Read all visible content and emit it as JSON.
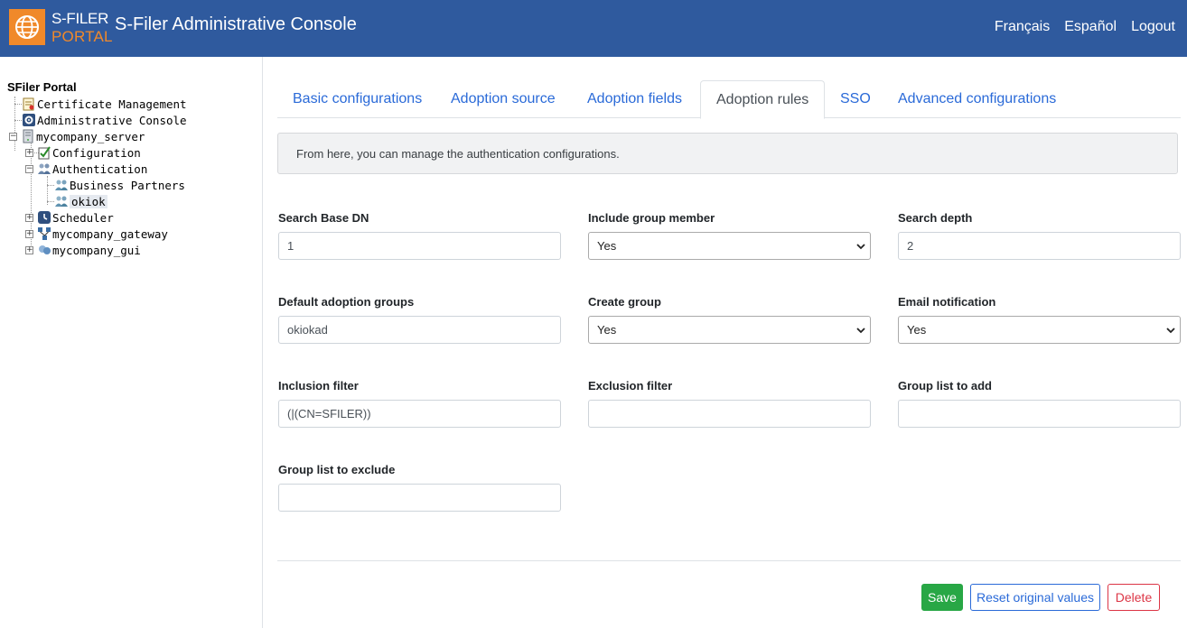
{
  "header": {
    "brand_line1": "S-FILER",
    "brand_line2": "PORTAL",
    "title": "S-Filer Administrative Console",
    "links": [
      "Français",
      "Español",
      "Logout"
    ]
  },
  "tree": {
    "root": "SFiler Portal",
    "items": {
      "cert": "Certificate Management",
      "admin": "Administrative Console",
      "server": "mycompany_server",
      "config": "Configuration",
      "auth": "Authentication",
      "bp": "Business Partners",
      "okiok": "okiok",
      "scheduler": "Scheduler",
      "gateway": "mycompany_gateway",
      "gui": "mycompany_gui"
    }
  },
  "tabs": [
    "Basic configurations",
    "Adoption source",
    "Adoption fields",
    "Adoption rules",
    "SSO",
    "Advanced configurations"
  ],
  "active_tab": "Adoption rules",
  "info": "From here, you can manage the authentication configurations.",
  "form": {
    "search_base_dn": {
      "label": "Search Base DN",
      "value": "1"
    },
    "include_group_member": {
      "label": "Include group member",
      "value": "Yes"
    },
    "search_depth": {
      "label": "Search depth",
      "value": "2"
    },
    "default_adoption_groups": {
      "label": "Default adoption groups",
      "value": "okiokad"
    },
    "create_group": {
      "label": "Create group",
      "value": "Yes"
    },
    "email_notification": {
      "label": "Email notification",
      "value": "Yes"
    },
    "inclusion_filter": {
      "label": "Inclusion filter",
      "value": "(|(CN=SFILER))"
    },
    "exclusion_filter": {
      "label": "Exclusion filter",
      "value": ""
    },
    "group_list_add": {
      "label": "Group list to add",
      "value": ""
    },
    "group_list_exclude": {
      "label": "Group list to exclude",
      "value": ""
    }
  },
  "buttons": {
    "save": "Save",
    "reset": "Reset original values",
    "delete": "Delete"
  },
  "colors": {
    "header": "#2f5a9e",
    "logo": "#f0892a",
    "link": "#2a6ad8",
    "save": "#28a745",
    "delete": "#dc3545"
  }
}
